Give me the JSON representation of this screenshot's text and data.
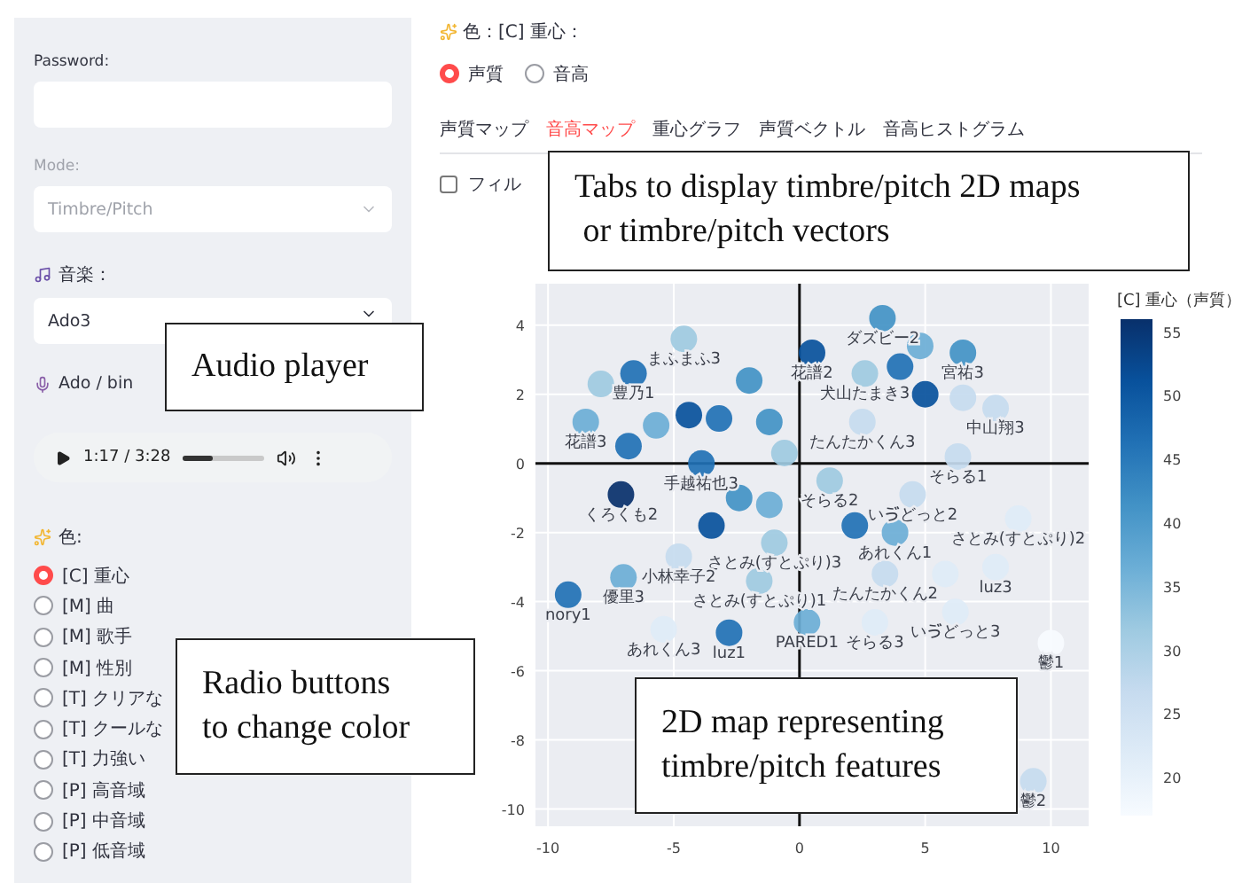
{
  "sidebar": {
    "password": {
      "label": "Password:"
    },
    "mode": {
      "label": "Mode:",
      "value": "Timbre/Pitch",
      "disabled": true
    },
    "music": {
      "label": "音楽：",
      "value": "Ado3"
    },
    "track": {
      "label": "Ado / bin"
    },
    "player": {
      "time": "1:17 / 3:28",
      "level": 0.37
    },
    "color": {
      "label": "色:",
      "options": [
        {
          "label": "[C] 重心",
          "selected": true
        },
        {
          "label": "[M] 曲",
          "selected": false
        },
        {
          "label": "[M] 歌手",
          "selected": false
        },
        {
          "label": "[M] 性別",
          "selected": false
        },
        {
          "label": "[T] クリアな",
          "selected": false
        },
        {
          "label": "[T] クールな",
          "selected": false
        },
        {
          "label": "[T] 力強い",
          "selected": false
        },
        {
          "label": "[P] 高音域",
          "selected": false
        },
        {
          "label": "[P] 中音域",
          "selected": false
        },
        {
          "label": "[P] 低音域",
          "selected": false
        }
      ]
    }
  },
  "main": {
    "heading": "色：[C] 重心：",
    "feature": [
      {
        "label": "声質",
        "selected": true
      },
      {
        "label": "音高",
        "selected": false
      }
    ],
    "tabs": [
      {
        "label": "声質マップ",
        "selected": false
      },
      {
        "label": "音高マップ",
        "selected": true
      },
      {
        "label": "重心グラフ",
        "selected": false
      },
      {
        "label": "声質ベクトル",
        "selected": false
      },
      {
        "label": "音高ヒストグラム",
        "selected": false
      }
    ],
    "filter": {
      "label": "フィル",
      "checked": false
    },
    "chart": {
      "colorbar": {
        "title": "[C] 重心（声質）",
        "ticks": [
          "55",
          "50",
          "45",
          "40",
          "35",
          "30",
          "25",
          "20"
        ]
      },
      "chart_data": {
        "type": "scatter",
        "grid": true,
        "xticks": [
          -10,
          -5,
          0,
          5,
          10
        ],
        "yticks": [
          -10,
          -8,
          -6,
          -4,
          -2,
          0,
          2,
          4
        ],
        "xlim": [
          -10.5,
          11.5
        ],
        "ylim": [
          -10.5,
          5.2
        ],
        "series": [
          {
            "name": "花譜2",
            "color": "#08519c",
            "x": [
              0.5
            ],
            "values": [
              3.2
            ]
          },
          {
            "name": "ダズビー2",
            "color": "#4292c6",
            "x": [
              3.3
            ],
            "values": [
              4.2
            ]
          },
          {
            "name": "犬山たまき3",
            "color": "#9ecae1",
            "x": [
              2.6
            ],
            "values": [
              2.6
            ]
          },
          {
            "name": "宮祐3",
            "color": "#4292c6",
            "x": [
              6.5
            ],
            "values": [
              3.2
            ]
          },
          {
            "name": "豊乃1",
            "color": "#2171b5",
            "x": [
              -6.6
            ],
            "values": [
              2.6
            ]
          },
          {
            "name": "まふまふ3",
            "color": "#9ecae1",
            "x": [
              -4.6
            ],
            "values": [
              3.6
            ]
          },
          {
            "name": "花譜3",
            "color": "#6baed6",
            "x": [
              -8.5
            ],
            "values": [
              1.2
            ]
          },
          {
            "name": "たんたかくん3",
            "color": "#c6dbef",
            "x": [
              2.5
            ],
            "values": [
              1.2
            ]
          },
          {
            "name": "中山翔3",
            "color": "#c6dbef",
            "x": [
              7.8
            ],
            "values": [
              1.6
            ]
          },
          {
            "name": "そらる1",
            "color": "#c6dbef",
            "x": [
              6.3
            ],
            "values": [
              0.2
            ]
          },
          {
            "name": "そらる2",
            "color": "#9ecae1",
            "x": [
              1.2
            ],
            "values": [
              -0.5
            ]
          },
          {
            "name": "いゔどっと2",
            "color": "#c6dbef",
            "x": [
              4.5
            ],
            "values": [
              -0.9
            ]
          },
          {
            "name": "さとみ(すとぷり)2",
            "color": "#deebf7",
            "x": [
              8.7
            ],
            "values": [
              -1.6
            ]
          },
          {
            "name": "あれくん1",
            "color": "#6baed6",
            "x": [
              3.8
            ],
            "values": [
              -2.0
            ]
          },
          {
            "name": "くろくも2",
            "color": "#08306b",
            "x": [
              -7.1
            ],
            "values": [
              -0.9
            ]
          },
          {
            "name": "手越祐也3",
            "color": "#2171b5",
            "x": [
              -3.9
            ],
            "values": [
              0.0
            ]
          },
          {
            "name": "luz3",
            "color": "#deebf7",
            "x": [
              7.8
            ],
            "values": [
              -3.0
            ]
          },
          {
            "name": "さとみ(すとぷり)3",
            "color": "#9ecae1",
            "x": [
              -1.0
            ],
            "values": [
              -2.3
            ]
          },
          {
            "name": "たんたかくん2",
            "color": "#c6dbef",
            "x": [
              3.4
            ],
            "values": [
              -3.2
            ]
          },
          {
            "name": "小林幸子2",
            "color": "#c6dbef",
            "x": [
              -4.8
            ],
            "values": [
              -2.7
            ]
          },
          {
            "name": "優里3",
            "color": "#6baed6",
            "x": [
              -7.0
            ],
            "values": [
              -3.3
            ]
          },
          {
            "name": "nory1",
            "color": "#2171b5",
            "x": [
              -9.2
            ],
            "values": [
              -3.8
            ]
          },
          {
            "name": "さとみ(すとぷり)1",
            "color": "#9ecae1",
            "x": [
              -1.6
            ],
            "values": [
              -3.4
            ]
          },
          {
            "name": "luz1",
            "color": "#2171b5",
            "x": [
              -2.8
            ],
            "values": [
              -4.9
            ]
          },
          {
            "name": "あれくん3",
            "color": "#deebf7",
            "x": [
              -5.4
            ],
            "values": [
              -4.8
            ]
          },
          {
            "name": "PARED1",
            "color": "#6baed6",
            "x": [
              0.3
            ],
            "values": [
              -4.6
            ]
          },
          {
            "name": "そらる3",
            "color": "#deebf7",
            "x": [
              3.0
            ],
            "values": [
              -4.6
            ]
          },
          {
            "name": "いゔどっと3",
            "color": "#deebf7",
            "x": [
              6.2
            ],
            "values": [
              -4.3
            ]
          },
          {
            "name": "鬱1",
            "color": "#f7fbff",
            "x": [
              10
            ],
            "values": [
              -5.2
            ]
          },
          {
            "name": "鬱2",
            "color": "#c6dbef",
            "x": [
              9.3
            ],
            "values": [
              -9.2
            ]
          },
          {
            "color": "#4292c6",
            "x": [
              -2.0
            ],
            "values": [
              2.4
            ]
          },
          {
            "color": "#2171b5",
            "x": [
              -3.2
            ],
            "values": [
              1.3
            ]
          },
          {
            "color": "#08519c",
            "x": [
              -4.4
            ],
            "values": [
              1.4
            ]
          },
          {
            "color": "#6baed6",
            "x": [
              -5.7
            ],
            "values": [
              1.1
            ]
          },
          {
            "color": "#4292c6",
            "x": [
              -1.2
            ],
            "values": [
              1.2
            ]
          },
          {
            "color": "#9ecae1",
            "x": [
              -0.6
            ],
            "values": [
              0.3
            ]
          },
          {
            "color": "#2171b5",
            "x": [
              4.0
            ],
            "values": [
              2.8
            ]
          },
          {
            "color": "#08519c",
            "x": [
              5.0
            ],
            "values": [
              2.0
            ]
          },
          {
            "color": "#6baed6",
            "x": [
              4.8
            ],
            "values": [
              3.4
            ]
          },
          {
            "color": "#2171b5",
            "x": [
              -6.8
            ],
            "values": [
              0.5
            ]
          },
          {
            "color": "#4292c6",
            "x": [
              -2.4
            ],
            "values": [
              -1.0
            ]
          },
          {
            "color": "#6baed6",
            "x": [
              -1.2
            ],
            "values": [
              -1.2
            ]
          },
          {
            "color": "#2171b5",
            "x": [
              2.2
            ],
            "values": [
              -1.8
            ]
          },
          {
            "color": "#08519c",
            "x": [
              -3.5
            ],
            "values": [
              -1.8
            ]
          },
          {
            "color": "#c6dbef",
            "x": [
              6.5
            ],
            "values": [
              1.9
            ]
          },
          {
            "color": "#9ecae1",
            "x": [
              -7.9
            ],
            "values": [
              2.3
            ]
          },
          {
            "color": "#deebf7",
            "x": [
              5.8
            ],
            "values": [
              -3.2
            ]
          }
        ]
      }
    }
  },
  "callouts": [
    {
      "text": "Audio player"
    },
    {
      "text": "Tabs to display timbre/pitch 2D maps\n or timbre/pitch vectors"
    },
    {
      "text": "Radio buttons\nto change color"
    },
    {
      "text": "2D map representing\ntimbre/pitch features"
    }
  ]
}
